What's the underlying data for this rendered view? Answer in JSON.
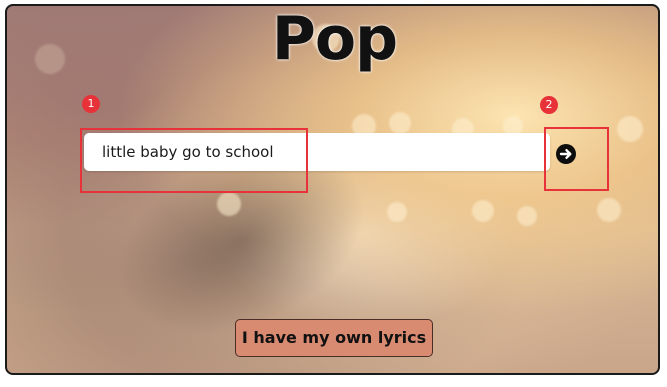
{
  "page": {
    "title": "Pop"
  },
  "search": {
    "value": "little baby go to school",
    "submit_icon": "arrow-right-circle-icon"
  },
  "annotations": [
    {
      "label": "1"
    },
    {
      "label": "2"
    }
  ],
  "actions": {
    "lyrics_button_label": "I have my own lyrics"
  },
  "colors": {
    "annotation": "#e8323a",
    "lyrics_button_bg": "#d98b72",
    "title_text": "#111111"
  }
}
